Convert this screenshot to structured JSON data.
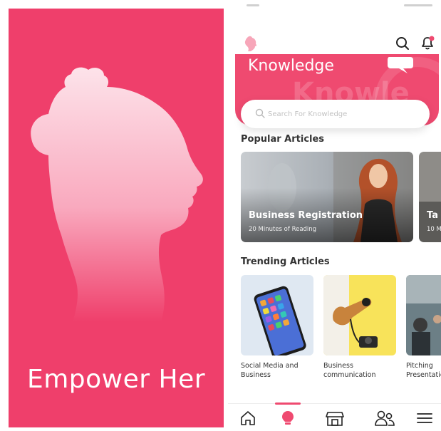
{
  "splash": {
    "title": "Empower Her",
    "background": "#ef3f6b"
  },
  "app": {
    "accent": "#ef4a70",
    "topbar": {
      "logo_icon": "woman-profile-logo-icon",
      "search_icon": "search-icon",
      "notification_icon": "bell-icon"
    },
    "hero": {
      "title": "Knowledge",
      "background_word": "Knowle"
    },
    "search": {
      "placeholder": "Search For Knowledge"
    },
    "popular": {
      "heading": "Popular Articles",
      "cards": [
        {
          "title": "Business Registration",
          "subtitle": "20 Minutes of Reading"
        },
        {
          "title": "Ta",
          "subtitle": "10 M"
        }
      ]
    },
    "trending": {
      "heading": "Trending Articles",
      "cards": [
        {
          "label": "Social Media and\nBusiness"
        },
        {
          "label": "Business\ncommunication"
        },
        {
          "label": "Pitching\nPresentatio"
        }
      ]
    },
    "bottom_nav": [
      {
        "icon": "home-icon"
      },
      {
        "icon": "lightbulb-icon",
        "active": true
      },
      {
        "icon": "store-icon"
      },
      {
        "icon": "community-icon"
      },
      {
        "icon": "menu-icon"
      }
    ]
  }
}
